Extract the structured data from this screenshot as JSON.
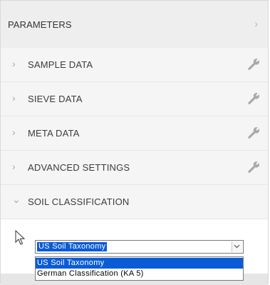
{
  "panel": {
    "title": "PARAMETERS",
    "collapse_glyph": "›"
  },
  "sections": [
    {
      "label": "SAMPLE DATA",
      "expanded": false,
      "has_settings": true
    },
    {
      "label": "SIEVE DATA",
      "expanded": false,
      "has_settings": true
    },
    {
      "label": "META DATA",
      "expanded": false,
      "has_settings": true
    },
    {
      "label": "ADVANCED SETTINGS",
      "expanded": false,
      "has_settings": true
    },
    {
      "label": "SOIL CLASSIFICATION",
      "expanded": true,
      "has_settings": false
    }
  ],
  "glyphs": {
    "collapsed": "›",
    "expanded": "⌄"
  },
  "icons": {
    "settings": "wrench-icon",
    "dropdown": "chevron-down-icon",
    "cursor": "mouse-pointer-icon"
  },
  "classification": {
    "selected": "US Soil Taxonomy",
    "options": [
      "US Soil Taxonomy",
      "German Classification (KA 5)"
    ],
    "highlighted_index": 0
  },
  "colors": {
    "selection": "#0a5bd6",
    "header_bg": "#eeeeee",
    "section_bg": "#f5f5f5",
    "wrench": "#a9a9a9"
  }
}
